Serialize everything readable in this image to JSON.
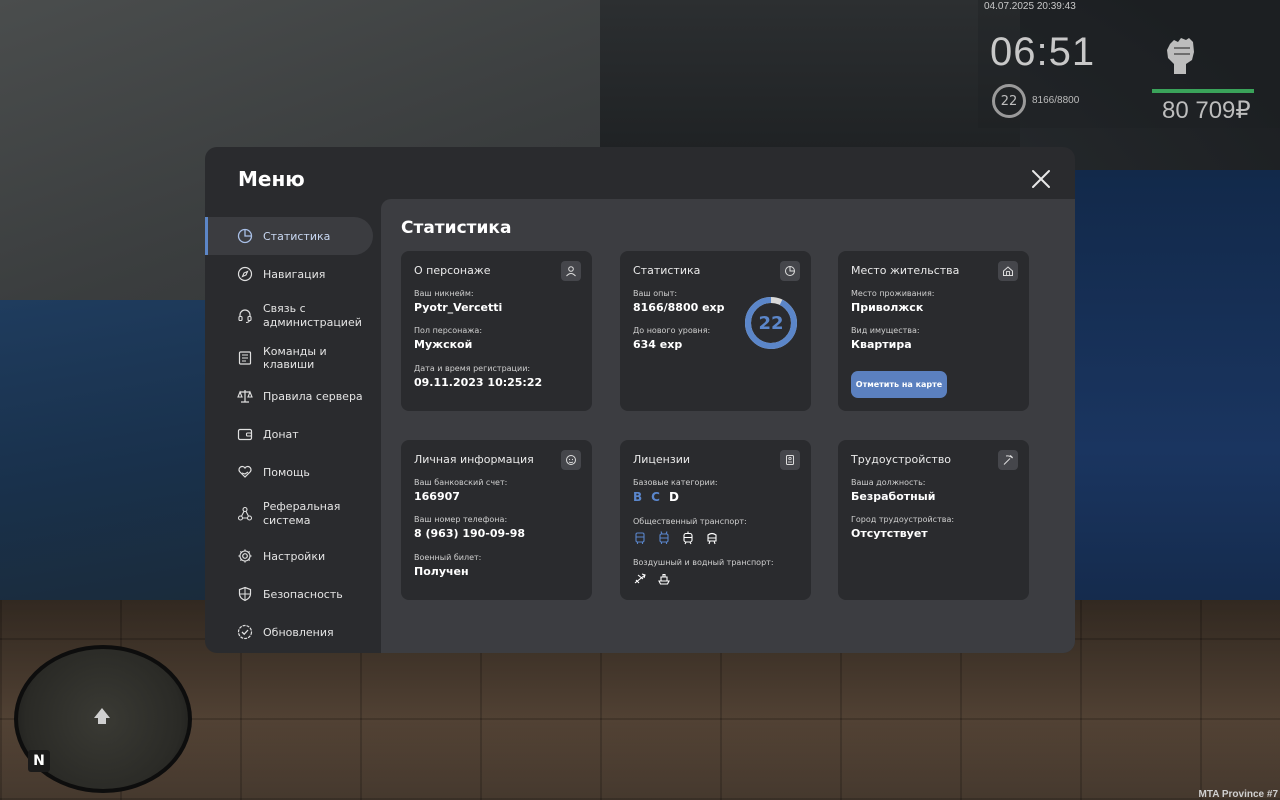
{
  "hud": {
    "datetime": "04.07.2025 20:39:43",
    "clock": "06:51",
    "level": "22",
    "exp": "8166/8800",
    "money": "80 709₽",
    "health_fraction": 1.0
  },
  "watermark": "MTA Province #7",
  "minimap": {
    "north_label": "N"
  },
  "menu": {
    "title": "Меню",
    "sidebar": [
      {
        "label": "Статистика",
        "icon": "pie-chart-icon",
        "active": true
      },
      {
        "label": "Навигация",
        "icon": "compass-icon",
        "active": false
      },
      {
        "label": "Связь с\nадминистрацией",
        "icon": "headset-icon",
        "active": false
      },
      {
        "label": "Команды и клавиши",
        "icon": "document-icon",
        "active": false
      },
      {
        "label": "Правила сервера",
        "icon": "scales-icon",
        "active": false
      },
      {
        "label": "Донат",
        "icon": "wallet-icon",
        "active": false
      },
      {
        "label": "Помощь",
        "icon": "heart-hand-icon",
        "active": false
      },
      {
        "label": "Реферальная\nсистема",
        "icon": "network-icon",
        "active": false
      },
      {
        "label": "Настройки",
        "icon": "gear-icon",
        "active": false
      },
      {
        "label": "Безопасность",
        "icon": "shield-icon",
        "active": false
      },
      {
        "label": "Обновления",
        "icon": "check-badge-icon",
        "active": false
      }
    ],
    "content_title": "Статистика",
    "cards": {
      "character": {
        "title": "О персонаже",
        "icon": "user-icon",
        "nickname_label": "Ваш никнейм:",
        "nickname": "Pyotr_Vercetti",
        "gender_label": "Пол персонажа:",
        "gender": "Мужской",
        "reg_label": "Дата и время регистрации:",
        "reg_date": "09.11.2023 10:25:22"
      },
      "stats": {
        "title": "Статистика",
        "icon": "chart-icon",
        "exp_label": "Ваш опыт:",
        "exp": "8166/8800 exp",
        "next_label": "До нового уровня:",
        "next": "634 exp",
        "level": "22",
        "progress": 0.928
      },
      "residence": {
        "title": "Место жительства",
        "icon": "home-icon",
        "place_label": "Место проживания:",
        "place": "Приволжск",
        "property_label": "Вид имущества:",
        "property": "Квартира",
        "button": "Отметить на карте"
      },
      "personal": {
        "title": "Личная информация",
        "icon": "face-icon",
        "bank_label": "Ваш банковский счет:",
        "bank": "166907",
        "phone_label": "Ваш номер телефона:",
        "phone": "8 (963) 190-09-98",
        "military_label": "Военный билет:",
        "military": "Получен"
      },
      "licenses": {
        "title": "Лицензии",
        "icon": "id-card-icon",
        "base_label": "Базовые категории:",
        "categories": [
          {
            "letter": "B",
            "owned": true
          },
          {
            "letter": "C",
            "owned": true
          },
          {
            "letter": "D",
            "owned": false
          }
        ],
        "public_label": "Общественный транспорт:",
        "public_icons": [
          "bus-icon",
          "trolleybus-icon",
          "tram-icon",
          "train-icon"
        ],
        "air_label": "Воздушный и водный транспорт:",
        "air_icons": [
          "plane-icon",
          "boat-icon"
        ]
      },
      "employment": {
        "title": "Трудоустройство",
        "icon": "pickaxe-icon",
        "position_label": "Ваша должность:",
        "position": "Безработный",
        "city_label": "Город трудоустройства:",
        "city": "Отсутствует"
      }
    }
  },
  "colors": {
    "accent": "#5b86c9",
    "panel": "#2a2b2e",
    "content_bg": "#3c3d41",
    "health": "#3aa35a"
  }
}
